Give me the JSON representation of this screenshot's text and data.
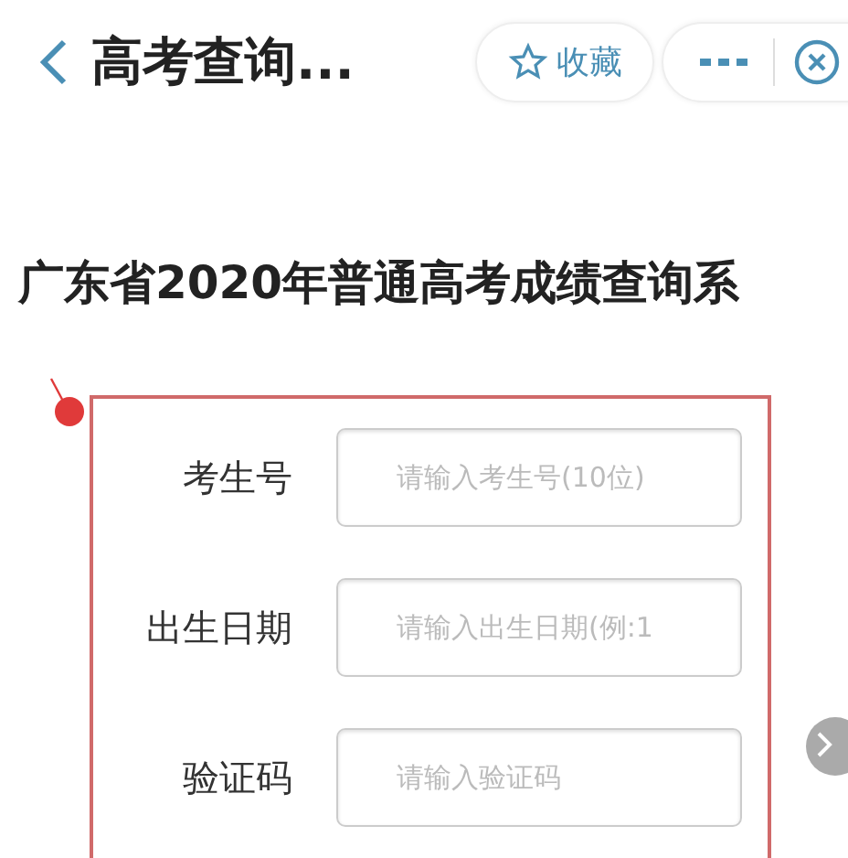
{
  "header": {
    "title": "高考查询...",
    "favorite_label": "收藏"
  },
  "heading": "广东省2020年普通高考成绩查询系",
  "form": {
    "fields": [
      {
        "label": "考生号",
        "placeholder": "请输入考生号(10位)"
      },
      {
        "label": "出生日期",
        "placeholder": "请输入出生日期(例:1"
      },
      {
        "label": "验证码",
        "placeholder": "请输入验证码"
      }
    ]
  }
}
